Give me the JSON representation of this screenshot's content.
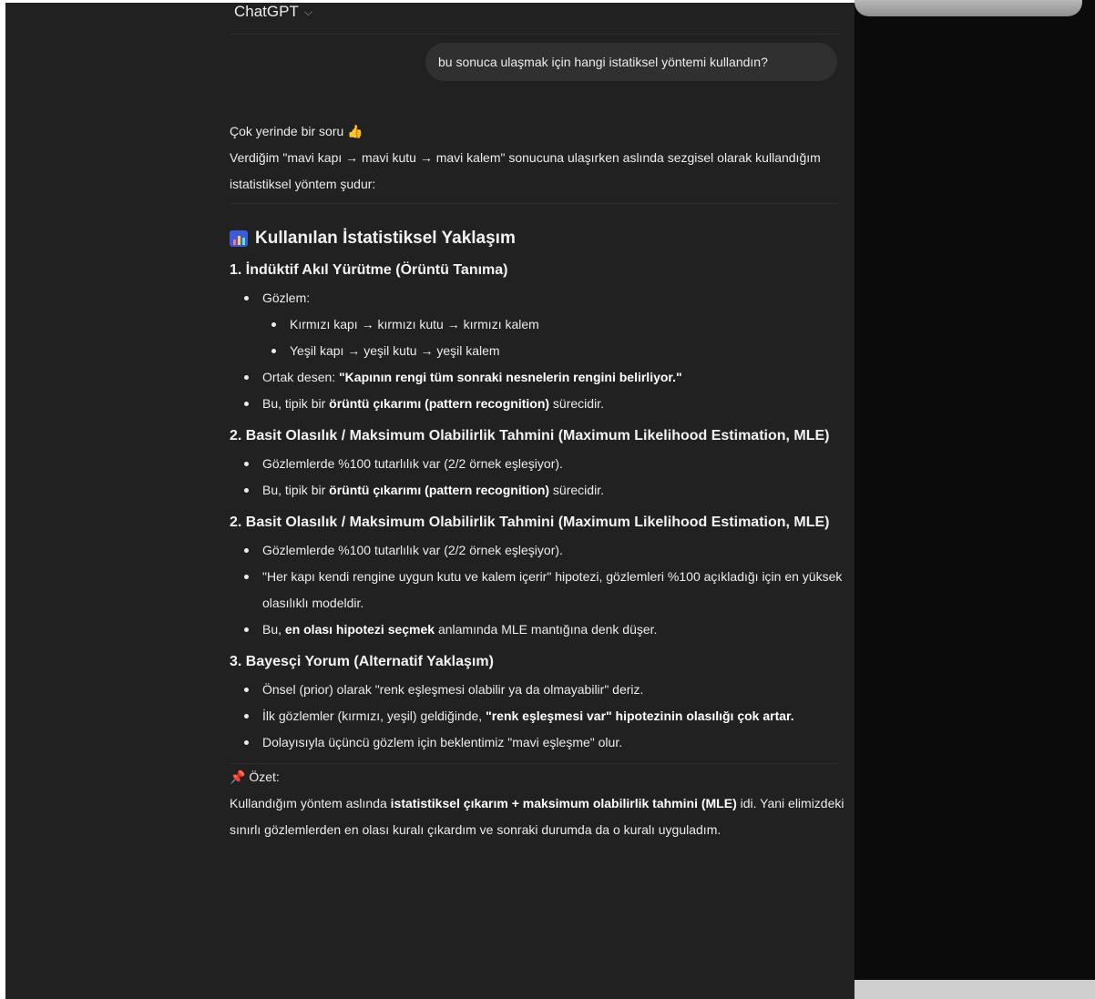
{
  "header": {
    "title": "ChatGPT",
    "chevron": "chevron-down-icon"
  },
  "user_message": "bu sonuca ulaşmak için hangi istatiksel yöntemi kullandın?",
  "assistant": {
    "intro_line1": "Çok yerinde bir soru",
    "intro_emoji": "👍",
    "intro_line2": "Verdiğim \"mavi kapı → mavi kutu → mavi kalem\" sonucuna ulaşırken aslında sezgisel olarak kullandığım istatistiksel yöntem şudur:",
    "section_title": "Kullanılan İstatistiksel Yaklaşım",
    "s1": {
      "title": "1. İndüktif Akıl Yürütme (Örüntü Tanıma)",
      "obs_label": "Gözlem:",
      "obs_items": [
        "Kırmızı kapı → kırmızı kutu → kırmızı kalem",
        "Yeşil kapı → yeşil kutu → yeşil kalem"
      ],
      "pattern_prefix": "Ortak desen: ",
      "pattern_bold": "\"Kapının rengi tüm sonraki nesnelerin rengini belirliyor.\"",
      "typical_prefix": "Bu, tipik bir ",
      "typical_bold": "örüntü çıkarımı (pattern recognition)",
      "typical_suffix": " sürecidir."
    },
    "s2a": {
      "title": "2. Basit Olasılık / Maksimum Olabilirlik Tahmini (Maximum Likelihood Estimation, MLE)",
      "item1": "Gözlemlerde %100 tutarlılık var (2/2 örnek eşleşiyor).",
      "item2_prefix": "Bu, tipik bir ",
      "item2_bold": "örüntü çıkarımı (pattern recognition)",
      "item2_suffix": " sürecidir."
    },
    "s2b": {
      "title": "2. Basit Olasılık / Maksimum Olabilirlik Tahmini (Maximum Likelihood Estimation, MLE)",
      "item1": "Gözlemlerde %100 tutarlılık var (2/2 örnek eşleşiyor).",
      "item2": "\"Her kapı kendi rengine uygun kutu ve kalem içerir\" hipotezi, gözlemleri %100 açıkladığı için en yüksek olasılıklı modeldir.",
      "item3_prefix": "Bu, ",
      "item3_bold": "en olası hipotezi seçmek",
      "item3_suffix": " anlamında MLE mantığına denk düşer."
    },
    "s3": {
      "title": "3. Bayesçi Yorum (Alternatif Yaklaşım)",
      "item1": "Önsel (prior) olarak \"renk eşleşmesi olabilir ya da olmayabilir\" deriz.",
      "item2_prefix": "İlk gözlemler (kırmızı, yeşil) geldiğinde, ",
      "item2_bold": "\"renk eşleşmesi var\" hipotezinin olasılığı çok artar.",
      "item3": "Dolayısıyla üçüncü gözlem için beklentimiz \"mavi eşleşme\" olur."
    },
    "summary": {
      "pin": "📌",
      "label": "Özet:",
      "line_prefix": "Kullandığım yöntem aslında ",
      "line_bold": "istatistiksel çıkarım + maksimum olabilirlik tahmini (MLE)",
      "line_suffix": " idi. Yani elimizdeki sınırlı gözlemlerden en olası kuralı çıkardım ve sonraki durumda da o kuralı uyguladım."
    }
  }
}
